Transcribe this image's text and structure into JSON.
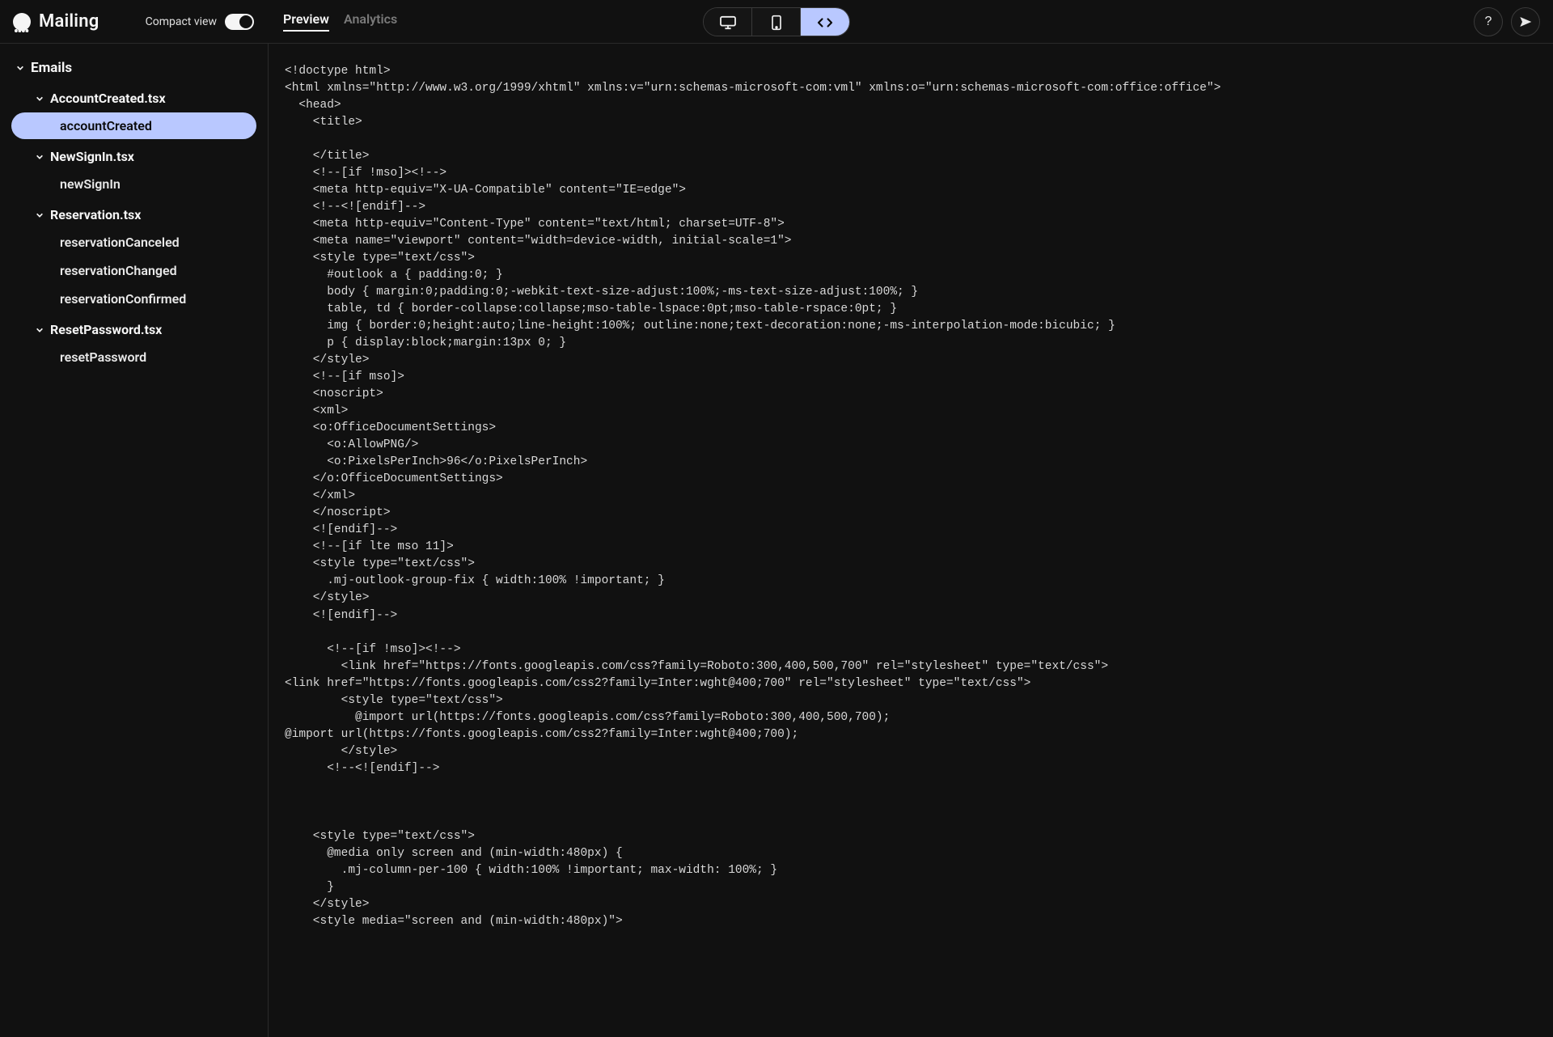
{
  "brand": {
    "name": "Mailing"
  },
  "topbar": {
    "compact_label": "Compact view",
    "tabs": {
      "preview": "Preview",
      "analytics": "Analytics"
    },
    "icons": {
      "desktop": "desktop-icon",
      "mobile": "mobile-icon",
      "code": "code-icon",
      "help": "help-icon",
      "send": "send-icon"
    }
  },
  "sidebar": {
    "root": "Emails",
    "groups": [
      {
        "label": "AccountCreated.tsx",
        "items": [
          "accountCreated"
        ]
      },
      {
        "label": "NewSignIn.tsx",
        "items": [
          "newSignIn"
        ]
      },
      {
        "label": "Reservation.tsx",
        "items": [
          "reservationCanceled",
          "reservationChanged",
          "reservationConfirmed"
        ]
      },
      {
        "label": "ResetPassword.tsx",
        "items": [
          "resetPassword"
        ]
      }
    ],
    "active_item": "accountCreated"
  },
  "code": "<!doctype html>\n<html xmlns=\"http://www.w3.org/1999/xhtml\" xmlns:v=\"urn:schemas-microsoft-com:vml\" xmlns:o=\"urn:schemas-microsoft-com:office:office\">\n  <head>\n    <title>\n      \n    </title>\n    <!--[if !mso]><!-->\n    <meta http-equiv=\"X-UA-Compatible\" content=\"IE=edge\">\n    <!--<![endif]-->\n    <meta http-equiv=\"Content-Type\" content=\"text/html; charset=UTF-8\">\n    <meta name=\"viewport\" content=\"width=device-width, initial-scale=1\">\n    <style type=\"text/css\">\n      #outlook a { padding:0; }\n      body { margin:0;padding:0;-webkit-text-size-adjust:100%;-ms-text-size-adjust:100%; }\n      table, td { border-collapse:collapse;mso-table-lspace:0pt;mso-table-rspace:0pt; }\n      img { border:0;height:auto;line-height:100%; outline:none;text-decoration:none;-ms-interpolation-mode:bicubic; }\n      p { display:block;margin:13px 0; }\n    </style>\n    <!--[if mso]>\n    <noscript>\n    <xml>\n    <o:OfficeDocumentSettings>\n      <o:AllowPNG/>\n      <o:PixelsPerInch>96</o:PixelsPerInch>\n    </o:OfficeDocumentSettings>\n    </xml>\n    </noscript>\n    <![endif]-->\n    <!--[if lte mso 11]>\n    <style type=\"text/css\">\n      .mj-outlook-group-fix { width:100% !important; }\n    </style>\n    <![endif]-->\n    \n      <!--[if !mso]><!-->\n        <link href=\"https://fonts.googleapis.com/css?family=Roboto:300,400,500,700\" rel=\"stylesheet\" type=\"text/css\">\n<link href=\"https://fonts.googleapis.com/css2?family=Inter:wght@400;700\" rel=\"stylesheet\" type=\"text/css\">\n        <style type=\"text/css\">\n          @import url(https://fonts.googleapis.com/css?family=Roboto:300,400,500,700);\n@import url(https://fonts.googleapis.com/css2?family=Inter:wght@400;700);\n        </style>\n      <!--<![endif]-->\n\n    \n    \n    <style type=\"text/css\">\n      @media only screen and (min-width:480px) {\n        .mj-column-per-100 { width:100% !important; max-width: 100%; }\n      }\n    </style>\n    <style media=\"screen and (min-width:480px)\">"
}
